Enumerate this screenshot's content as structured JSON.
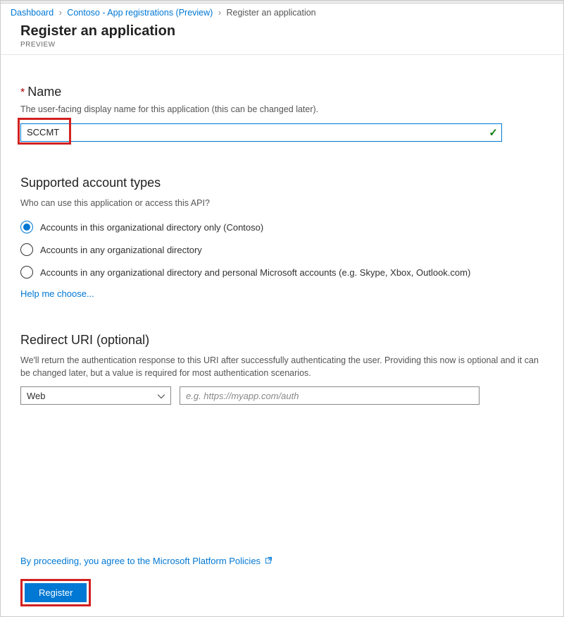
{
  "breadcrumb": {
    "items": [
      {
        "label": "Dashboard",
        "link": true
      },
      {
        "label": "Contoso - App registrations (Preview)",
        "link": true
      },
      {
        "label": "Register an application",
        "link": false
      }
    ]
  },
  "header": {
    "title": "Register an application",
    "preview": "PREVIEW"
  },
  "name_section": {
    "required_marker": "*",
    "label": "Name",
    "helper": "The user-facing display name for this application (this can be changed later).",
    "value": "SCCMT"
  },
  "account_section": {
    "label": "Supported account types",
    "helper": "Who can use this application or access this API?",
    "options": [
      {
        "label": "Accounts in this organizational directory only (Contoso)",
        "selected": true
      },
      {
        "label": "Accounts in any organizational directory",
        "selected": false
      },
      {
        "label": "Accounts in any organizational directory and personal Microsoft accounts (e.g. Skype, Xbox, Outlook.com)",
        "selected": false
      }
    ],
    "help_link": "Help me choose..."
  },
  "redirect_section": {
    "label": "Redirect URI (optional)",
    "helper": "We'll return the authentication response to this URI after successfully authenticating the user. Providing this now is optional and it can be changed later, but a value is required for most authentication scenarios.",
    "type_value": "Web",
    "uri_placeholder": "e.g. https://myapp.com/auth"
  },
  "footer": {
    "agree_text": "By proceeding, you agree to the Microsoft Platform Policies",
    "register_label": "Register"
  }
}
